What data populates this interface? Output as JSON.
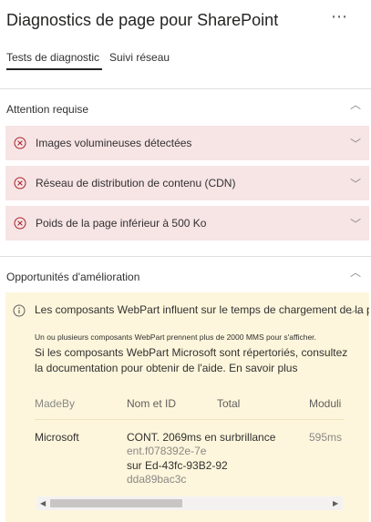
{
  "header": {
    "title": "Diagnostics de page pour SharePoint",
    "more_icon": "more-icon",
    "more_glyph": "⋯"
  },
  "tabs": [
    {
      "label": "Tests de diagnostic",
      "active": true
    },
    {
      "label": "Suivi réseau",
      "active": false
    }
  ],
  "attention": {
    "title": "Attention requise",
    "items": [
      {
        "label": "Images volumineuses détectées",
        "icon": "error-circle-icon"
      },
      {
        "label": "Réseau de distribution de contenu (CDN)",
        "icon": "error-circle-icon"
      },
      {
        "label": "Poids de la page inférieur à 500 Ko",
        "icon": "error-circle-icon"
      }
    ]
  },
  "opportunities": {
    "title": "Opportunités d'amélioration",
    "item": {
      "title": "Les composants WebPart influent sur le temps de chargement de la page",
      "icon": "info-icon",
      "note": "Un ou plusieurs composants WebPart prennent plus de 2000 MMS pour s'afficher.",
      "description": "Si les composants WebPart Microsoft sont répertoriés, consultez la documentation pour obtenir de l'aide. En savoir plus",
      "table": {
        "headers": [
          "MadeBy",
          "Nom et ID",
          "Total",
          "Moduli"
        ],
        "row": {
          "madeby": "Microsoft",
          "name_line1": "CONT. 2069ms en surbrillance",
          "name_line2": "ent.f078392e-7e",
          "name_line3": "sur Ed-43fc-93B2-92",
          "name_line4": "dda89bac3c",
          "total": "595ms"
        }
      }
    }
  },
  "glyphs": {
    "chevron_up": "︿",
    "chevron_down": "﹀",
    "arrow_left": "◀",
    "arrow_right": "▶"
  },
  "colors": {
    "error_bg": "#f7e4e5",
    "error_icon": "#a4262c",
    "info_bg": "#fdf6dc",
    "tab_underline": "#252423"
  }
}
